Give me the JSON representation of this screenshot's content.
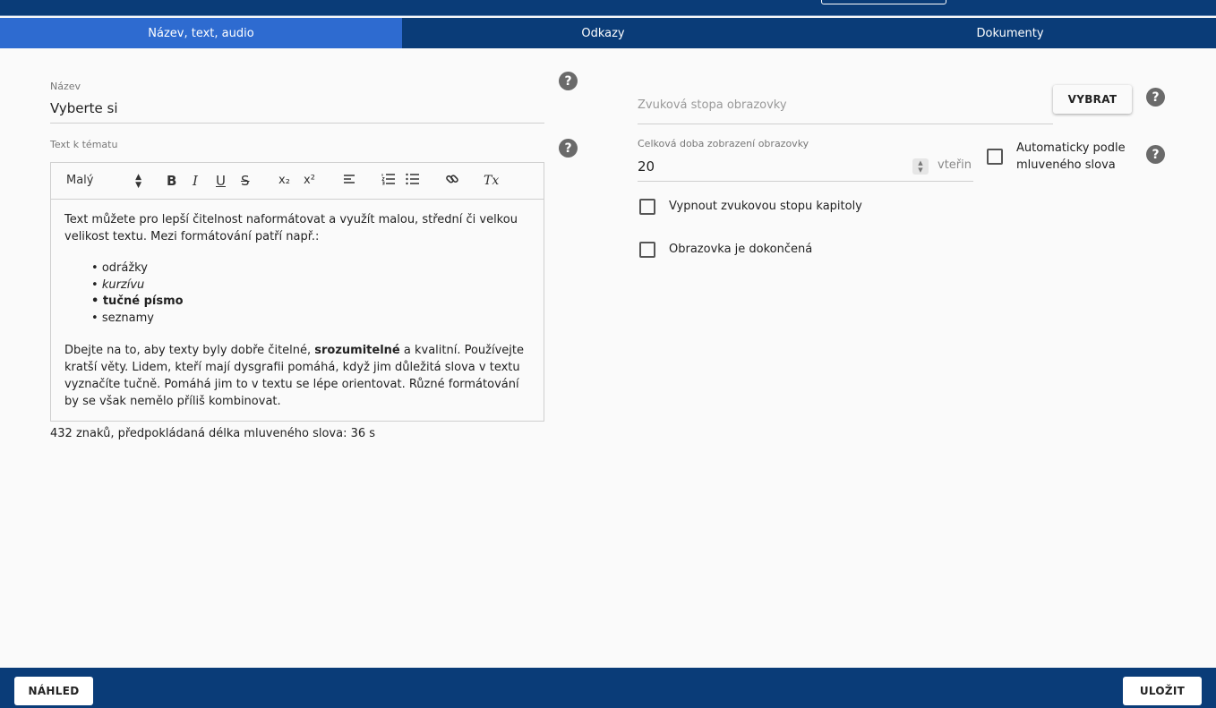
{
  "tabs": [
    {
      "label": "Název, text, audio"
    },
    {
      "label": "Odkazy"
    },
    {
      "label": "Dokumenty"
    }
  ],
  "title_field": {
    "label": "Název",
    "value": "Vyberte si"
  },
  "text_field": {
    "label": "Text k tématu"
  },
  "toolbar": {
    "size_value": "Malý",
    "bold": "B",
    "italic": "I",
    "underline": "U",
    "strike": "S",
    "subscript": "x₂",
    "superscript": "x²",
    "clear_format": "Tx"
  },
  "editor": {
    "para1": "Text můžete pro lepší čitelnost naformátovat a využít malou, střední či velkou velikost textu. Mezi formátování patří např.:",
    "list": [
      "odrážky",
      "kurzívu",
      "tučné písmo",
      "seznamy"
    ],
    "para2_a": "Dbejte na to, aby texty byly dobře čitelné, ",
    "para2_bold": "srozumitelné",
    "para2_b": " a kvalitní. Používejte kratší věty. Lidem, kteří mají dysgrafii pomáhá, když jim důležitá slova v textu vyznačíte tučně. Pomáhá jim to v textu se lépe orientovat. Různé formátování by se však nemělo příliš kombinovat."
  },
  "char_count": "432 znaků, předpokládaná délka mluveného slova: 36 s",
  "audio": {
    "placeholder": "Zvuková stopa obrazovky",
    "select_button": "VYBRAT"
  },
  "duration": {
    "label": "Celková doba zobrazení obrazovky",
    "value": "20",
    "unit": "vteřin"
  },
  "auto_checkbox": {
    "label": "Automaticky podle mluveného slova",
    "checked": false
  },
  "disable_audio_checkbox": {
    "label": "Vypnout zvukovou stopu kapitoly",
    "checked": false
  },
  "done_checkbox": {
    "label": "Obrazovka je dokončená",
    "checked": false
  },
  "footer": {
    "preview_button": "NÁHLED",
    "save_button": "ULOŽIT"
  },
  "help_icon": "?",
  "colors": {
    "navy": "#0a3c78",
    "active_tab": "#2e6bd0",
    "help_icon": "#6a6a6a"
  }
}
